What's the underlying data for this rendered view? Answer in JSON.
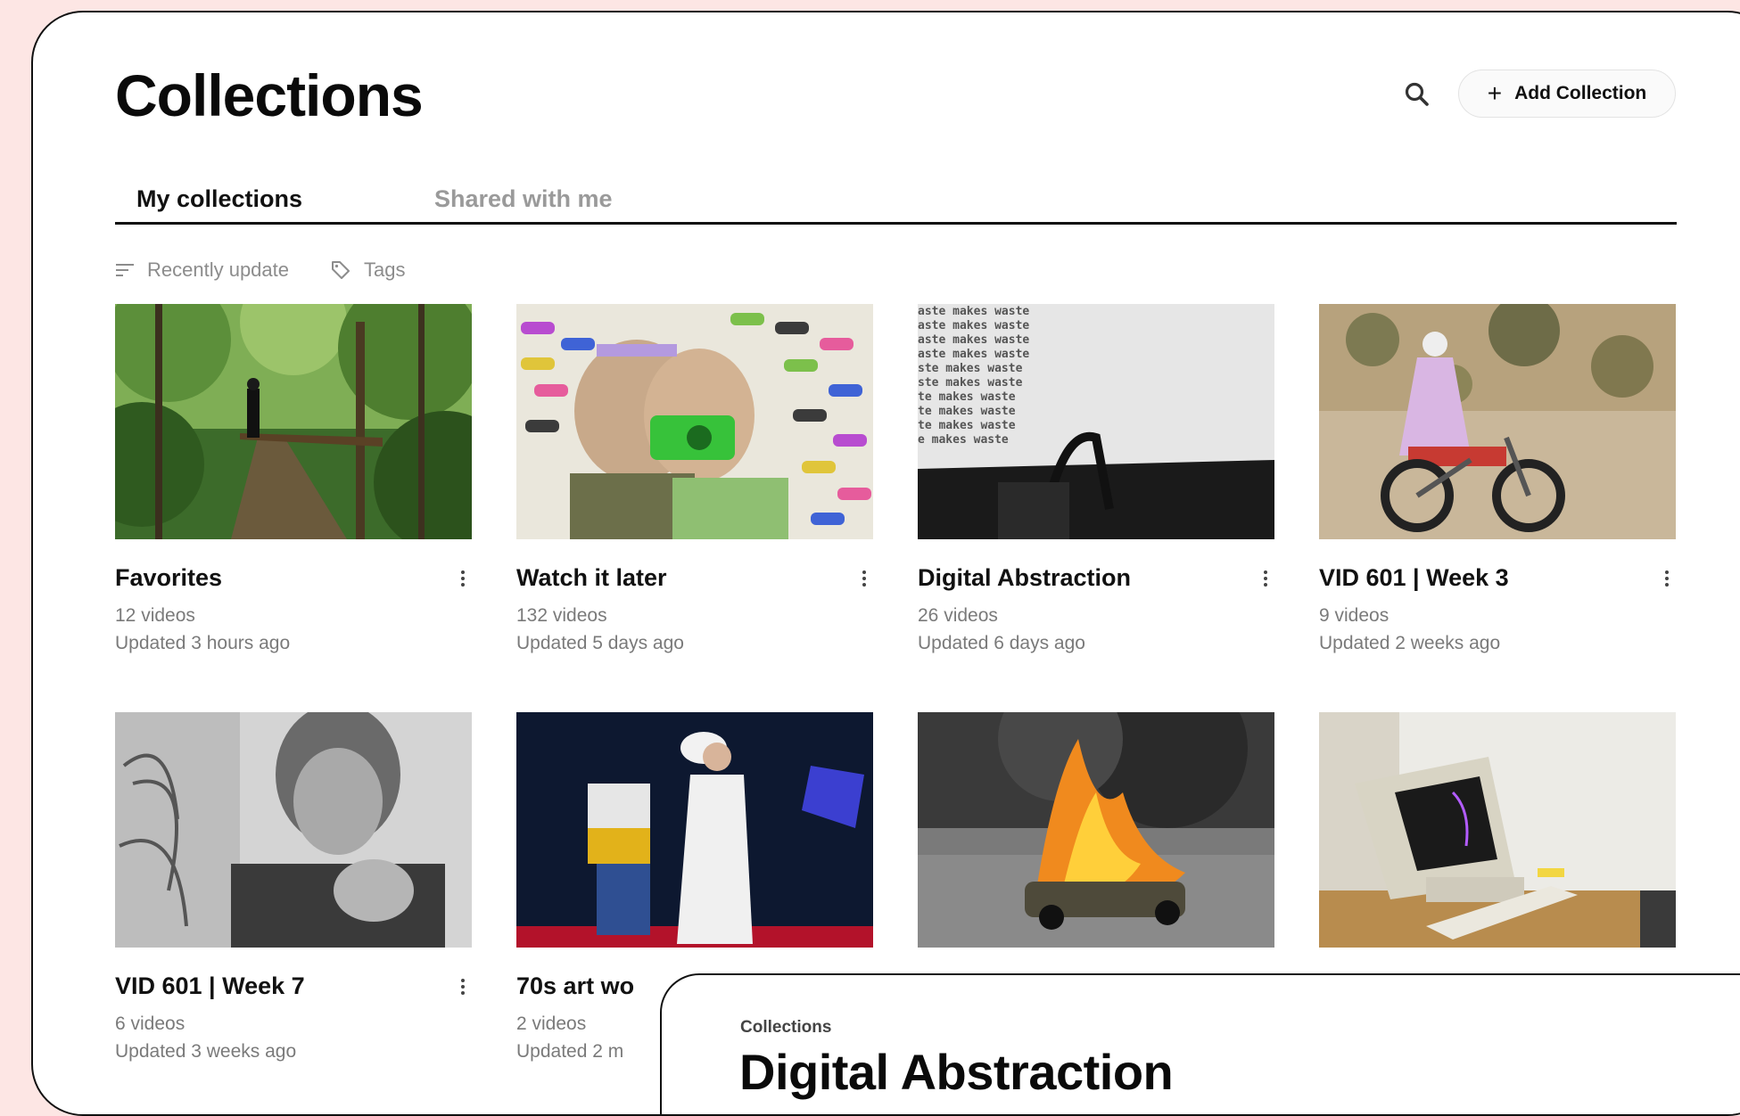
{
  "header": {
    "title": "Collections",
    "add_label": "Add Collection",
    "add_icon": "plus-icon",
    "search_icon": "search-icon"
  },
  "tabs": [
    {
      "label": "My collections",
      "active": true
    },
    {
      "label": "Shared with me",
      "active": false
    }
  ],
  "filters": {
    "sort_label": "Recently update",
    "sort_icon": "sort-lines-icon",
    "tags_label": "Tags",
    "tags_icon": "tag-icon"
  },
  "collections": [
    {
      "title": "Favorites",
      "count": "12 videos",
      "updated": "Updated 3 hours ago"
    },
    {
      "title": "Watch it later",
      "count": "132 videos",
      "updated": "Updated 5 days ago"
    },
    {
      "title": "Digital Abstraction",
      "count": "26 videos",
      "updated": "Updated 6 days ago"
    },
    {
      "title": "VID 601 | Week 3",
      "count": "9 videos",
      "updated": "Updated 2 weeks ago"
    },
    {
      "title": "VID 601 | Week 7",
      "count": "6 videos",
      "updated": "Updated 3 weeks ago"
    },
    {
      "title": "70s art wo",
      "count": "2 videos",
      "updated": "Updated 2 m"
    },
    {
      "title": "",
      "count": "",
      "updated": ""
    },
    {
      "title": "",
      "count": "",
      "updated": ""
    }
  ],
  "overlay": {
    "breadcrumb": "Collections",
    "title": "Digital Abstraction"
  },
  "colors": {
    "background": "#fde6e4",
    "text": "#111111",
    "muted": "#7a7a7a"
  }
}
